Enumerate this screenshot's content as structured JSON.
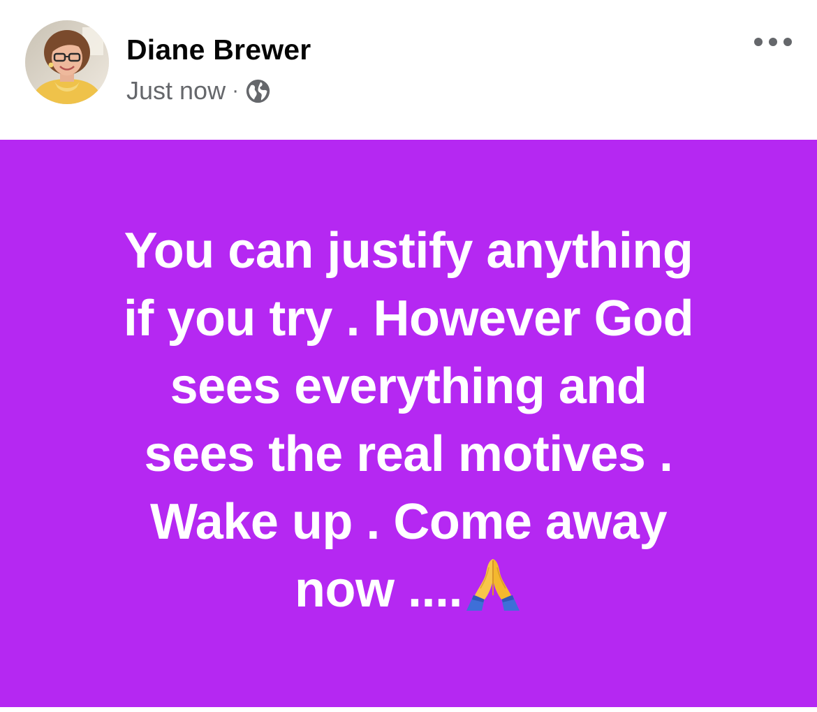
{
  "post": {
    "author_name": "Diane Brewer",
    "timestamp": "Just now",
    "separator": "·",
    "audience_icon": "globe-icon",
    "more_icon": "more-options-icon",
    "background_color": "#b528f2",
    "text_color": "#ffffff",
    "lines": [
      "You can justify anything",
      "if you try . However God",
      "sees everything and",
      "sees the real motives .",
      "Wake up .  Come away",
      "now ...."
    ],
    "emoji": "folded-hands-emoji"
  }
}
